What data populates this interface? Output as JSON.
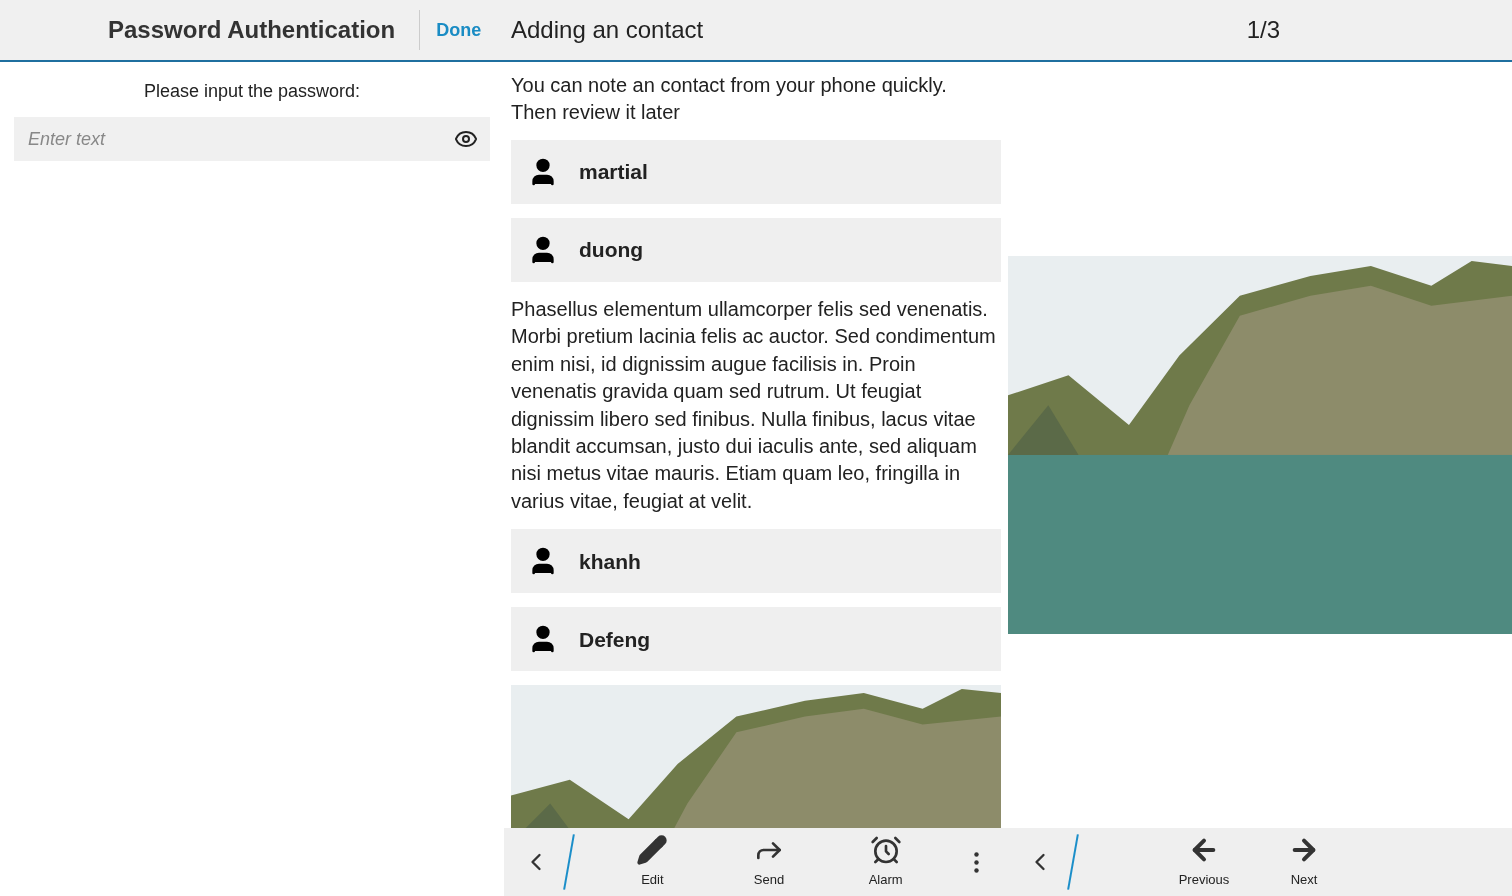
{
  "password_panel": {
    "title": "Password Authentication",
    "done": "Done",
    "prompt": "Please input the password:",
    "field": {
      "placeholder": "Enter text"
    }
  },
  "contact_panel": {
    "title": "Adding an contact",
    "intro": "You can note an contact from your phone  quickly. Then review it later",
    "items": [
      {
        "kind": "contact",
        "name": "martial"
      },
      {
        "kind": "contact",
        "name": "duong"
      },
      {
        "kind": "paragraph",
        "text": "Phasellus elementum ullamcorper felis sed venenatis. Morbi pretium lacinia felis ac auctor. Sed condimentum enim nisi, id dignissim augue facilisis in. Proin venenatis gravida quam sed rutrum. Ut feugiat dignissim libero sed finibus. Nulla finibus, lacus vitae blandit accumsan, justo dui iaculis ante, sed aliquam nisi metus vitae mauris. Etiam quam leo, fringilla in varius vitae, feugiat at velit."
      },
      {
        "kind": "contact",
        "name": "khanh"
      },
      {
        "kind": "contact",
        "name": "Defeng"
      },
      {
        "kind": "photo"
      }
    ],
    "actions": [
      {
        "kind": "edit",
        "label": "Edit"
      },
      {
        "kind": "send",
        "label": "Send"
      },
      {
        "kind": "alarm",
        "label": "Alarm"
      }
    ]
  },
  "viewer_panel": {
    "counter": "1/3",
    "actions": [
      {
        "kind": "previous",
        "label": "Previous"
      },
      {
        "kind": "next",
        "label": "Next"
      }
    ]
  }
}
